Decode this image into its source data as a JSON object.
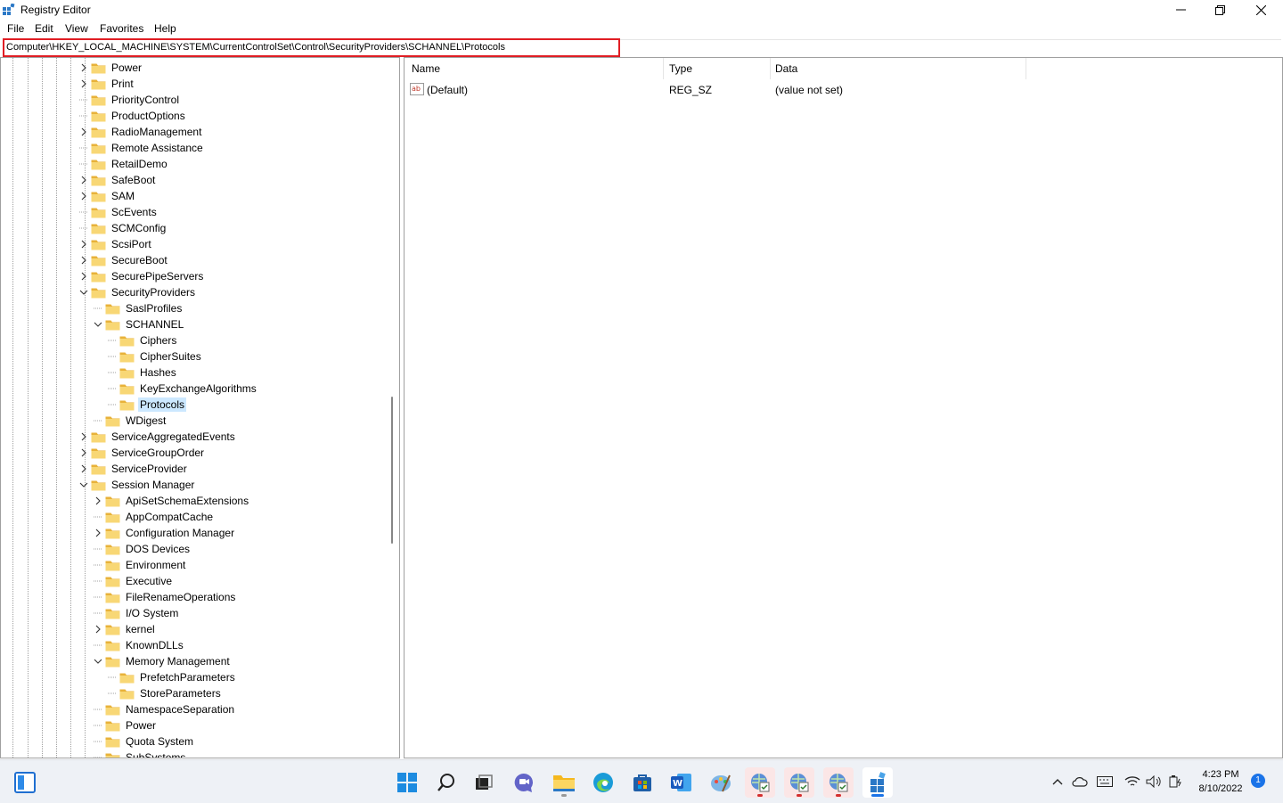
{
  "window": {
    "title": "Registry Editor"
  },
  "menu": {
    "items": [
      "File",
      "Edit",
      "View",
      "Favorites",
      "Help"
    ]
  },
  "address": {
    "path": "Computer\\HKEY_LOCAL_MACHINE\\SYSTEM\\CurrentControlSet\\Control\\SecurityProviders\\SCHANNEL\\Protocols"
  },
  "tree": {
    "items": [
      {
        "label": "Power",
        "level": 0,
        "expander": "collapsed"
      },
      {
        "label": "Print",
        "level": 0,
        "expander": "collapsed"
      },
      {
        "label": "PriorityControl",
        "level": 0,
        "expander": "none"
      },
      {
        "label": "ProductOptions",
        "level": 0,
        "expander": "none"
      },
      {
        "label": "RadioManagement",
        "level": 0,
        "expander": "collapsed"
      },
      {
        "label": "Remote Assistance",
        "level": 0,
        "expander": "none"
      },
      {
        "label": "RetailDemo",
        "level": 0,
        "expander": "none"
      },
      {
        "label": "SafeBoot",
        "level": 0,
        "expander": "collapsed"
      },
      {
        "label": "SAM",
        "level": 0,
        "expander": "collapsed"
      },
      {
        "label": "ScEvents",
        "level": 0,
        "expander": "none"
      },
      {
        "label": "SCMConfig",
        "level": 0,
        "expander": "none"
      },
      {
        "label": "ScsiPort",
        "level": 0,
        "expander": "collapsed"
      },
      {
        "label": "SecureBoot",
        "level": 0,
        "expander": "collapsed"
      },
      {
        "label": "SecurePipeServers",
        "level": 0,
        "expander": "collapsed"
      },
      {
        "label": "SecurityProviders",
        "level": 0,
        "expander": "expanded"
      },
      {
        "label": "SaslProfiles",
        "level": 1,
        "expander": "none"
      },
      {
        "label": "SCHANNEL",
        "level": 1,
        "expander": "expanded"
      },
      {
        "label": "Ciphers",
        "level": 2,
        "expander": "none"
      },
      {
        "label": "CipherSuites",
        "level": 2,
        "expander": "none"
      },
      {
        "label": "Hashes",
        "level": 2,
        "expander": "none"
      },
      {
        "label": "KeyExchangeAlgorithms",
        "level": 2,
        "expander": "none"
      },
      {
        "label": "Protocols",
        "level": 2,
        "expander": "none",
        "selected": true
      },
      {
        "label": "WDigest",
        "level": 1,
        "expander": "none"
      },
      {
        "label": "ServiceAggregatedEvents",
        "level": 0,
        "expander": "collapsed"
      },
      {
        "label": "ServiceGroupOrder",
        "level": 0,
        "expander": "collapsed"
      },
      {
        "label": "ServiceProvider",
        "level": 0,
        "expander": "collapsed"
      },
      {
        "label": "Session Manager",
        "level": 0,
        "expander": "expanded"
      },
      {
        "label": "ApiSetSchemaExtensions",
        "level": 1,
        "expander": "collapsed"
      },
      {
        "label": "AppCompatCache",
        "level": 1,
        "expander": "none"
      },
      {
        "label": "Configuration Manager",
        "level": 1,
        "expander": "collapsed"
      },
      {
        "label": "DOS Devices",
        "level": 1,
        "expander": "none"
      },
      {
        "label": "Environment",
        "level": 1,
        "expander": "none"
      },
      {
        "label": "Executive",
        "level": 1,
        "expander": "none"
      },
      {
        "label": "FileRenameOperations",
        "level": 1,
        "expander": "none"
      },
      {
        "label": "I/O System",
        "level": 1,
        "expander": "none"
      },
      {
        "label": "kernel",
        "level": 1,
        "expander": "collapsed"
      },
      {
        "label": "KnownDLLs",
        "level": 1,
        "expander": "none"
      },
      {
        "label": "Memory Management",
        "level": 1,
        "expander": "expanded"
      },
      {
        "label": "PrefetchParameters",
        "level": 2,
        "expander": "none"
      },
      {
        "label": "StoreParameters",
        "level": 2,
        "expander": "none"
      },
      {
        "label": "NamespaceSeparation",
        "level": 1,
        "expander": "none"
      },
      {
        "label": "Power",
        "level": 1,
        "expander": "none"
      },
      {
        "label": "Quota System",
        "level": 1,
        "expander": "none"
      },
      {
        "label": "SubSystems",
        "level": 1,
        "expander": "none"
      }
    ]
  },
  "values": {
    "columns": [
      "Name",
      "Type",
      "Data"
    ],
    "rows": [
      {
        "name": "(Default)",
        "type": "REG_SZ",
        "data": "(value not set)",
        "icon": "string-value-icon"
      }
    ]
  },
  "taskbar": {
    "apps": [
      {
        "name": "start-button"
      },
      {
        "name": "search-button"
      },
      {
        "name": "task-view-button"
      },
      {
        "name": "chat-button"
      },
      {
        "name": "file-explorer-button"
      },
      {
        "name": "edge-button"
      },
      {
        "name": "store-button"
      },
      {
        "name": "word-button"
      },
      {
        "name": "paint-button"
      },
      {
        "name": "remote-app-1-button"
      },
      {
        "name": "remote-app-2-button"
      },
      {
        "name": "remote-app-3-button"
      },
      {
        "name": "registry-editor-button"
      }
    ],
    "time": "4:23 PM",
    "date": "8/10/2022",
    "notification_count": "1"
  },
  "colors": {
    "highlight": "#e01e24",
    "selection": "#cce8ff",
    "folder": "#f8d775"
  }
}
